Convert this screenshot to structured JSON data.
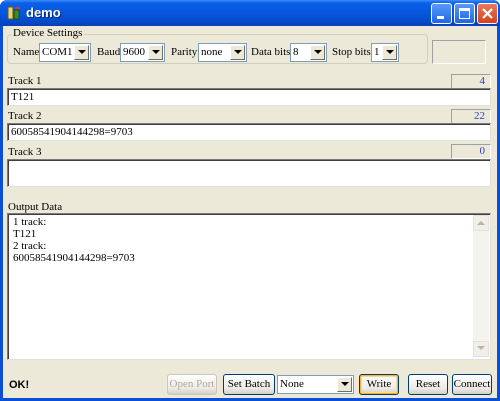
{
  "window": {
    "title": "demo"
  },
  "device_settings": {
    "label": "Device Settings",
    "name_label": "Name",
    "name_value": "COM1",
    "baud_label": "Baud",
    "baud_value": "9600",
    "parity_label": "Parity",
    "parity_value": "none",
    "databits_label": "Data bits",
    "databits_value": "8",
    "stopbits_label": "Stop bits",
    "stopbits_value": "1"
  },
  "tracks": [
    {
      "label": "Track 1",
      "count": "4",
      "value": "T121"
    },
    {
      "label": "Track 2",
      "count": "22",
      "value": "6005854190414429​8=9703"
    },
    {
      "label": "Track 3",
      "count": "0",
      "value": ""
    }
  ],
  "output": {
    "label": "Output Data",
    "lines": [
      "1 track:",
      "T121",
      "2 track:",
      "6005854190414429​8=9703"
    ]
  },
  "bottom": {
    "status": "OK!",
    "open_port": "Open Port",
    "set_batch": "Set Batch",
    "batch_value": "None",
    "write": "Write",
    "reset": "Reset",
    "connect": "Connect"
  },
  "colors": {
    "titlebar": "#0656dc",
    "face": "#ece9d8",
    "count_text": "#2a42c8"
  }
}
